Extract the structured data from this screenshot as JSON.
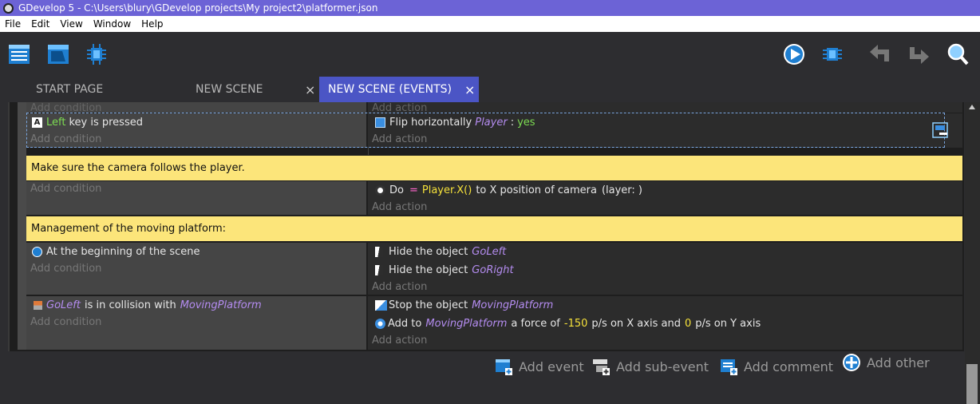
{
  "window": {
    "title": "GDevelop 5 - C:\\Users\\blury\\GDevelop projects\\My project2\\platformer.json"
  },
  "menu": [
    "File",
    "Edit",
    "View",
    "Window",
    "Help"
  ],
  "tabs": [
    {
      "label": "START PAGE"
    },
    {
      "label": "NEW SCENE",
      "close": "×"
    },
    {
      "label": "NEW SCENE (EVENTS)",
      "close": "×"
    }
  ],
  "events": {
    "partial_top": {
      "condition": "Add condition",
      "action": "Add action"
    },
    "event1": {
      "cond_key": "Left",
      "cond_rest": "key is pressed",
      "act_text": "Flip horizontally",
      "act_obj": "Player",
      "act_sep": ":",
      "act_val": "yes",
      "add_condition": "Add condition",
      "add_action": "Add action"
    },
    "comment1": "Make sure the camera follows the player.",
    "event2": {
      "add_condition": "Add condition",
      "act_do": "Do",
      "act_op": "=",
      "act_expr": "Player.X()",
      "act_rest": "to X position of camera",
      "act_layer": "(layer: )",
      "add_action": "Add action"
    },
    "comment2": "Management of the moving platform:",
    "event3": {
      "cond": "At the beginning of the scene",
      "add_condition": "Add condition",
      "act1_text": "Hide the object",
      "act1_obj": "GoLeft",
      "act2_text": "Hide the object",
      "act2_obj": "GoRight",
      "add_action": "Add action"
    },
    "event4": {
      "cond_obj1": "GoLeft",
      "cond_mid": "is in collision with",
      "cond_obj2": "MovingPlatform",
      "add_condition": "Add condition",
      "act1_text": "Stop the object",
      "act1_obj": "MovingPlatform",
      "act2_a": "Add to",
      "act2_obj": "MovingPlatform",
      "act2_b": "a force of",
      "act2_v1": "-150",
      "act2_c": "p/s on X axis and",
      "act2_v2": "0",
      "act2_d": "p/s on Y axis",
      "add_action": "Add action"
    }
  },
  "bottom": {
    "add_event": "Add event",
    "add_subevent": "Add sub-event",
    "add_comment": "Add comment",
    "add_other": "Add other"
  },
  "colors": {
    "titlebar": "#6c63d6",
    "active_tab": "#4b55c5",
    "comment_bg": "#fce57a",
    "param_green": "#7ddc52",
    "param_object": "#b48cf0",
    "param_number": "#f5e13a"
  },
  "icons": [
    "project-manager-icon",
    "scene-properties-icon",
    "debugger-icon",
    "preview-play-icon",
    "network-debugger-icon",
    "undo-icon",
    "redo-icon",
    "search-icon"
  ]
}
